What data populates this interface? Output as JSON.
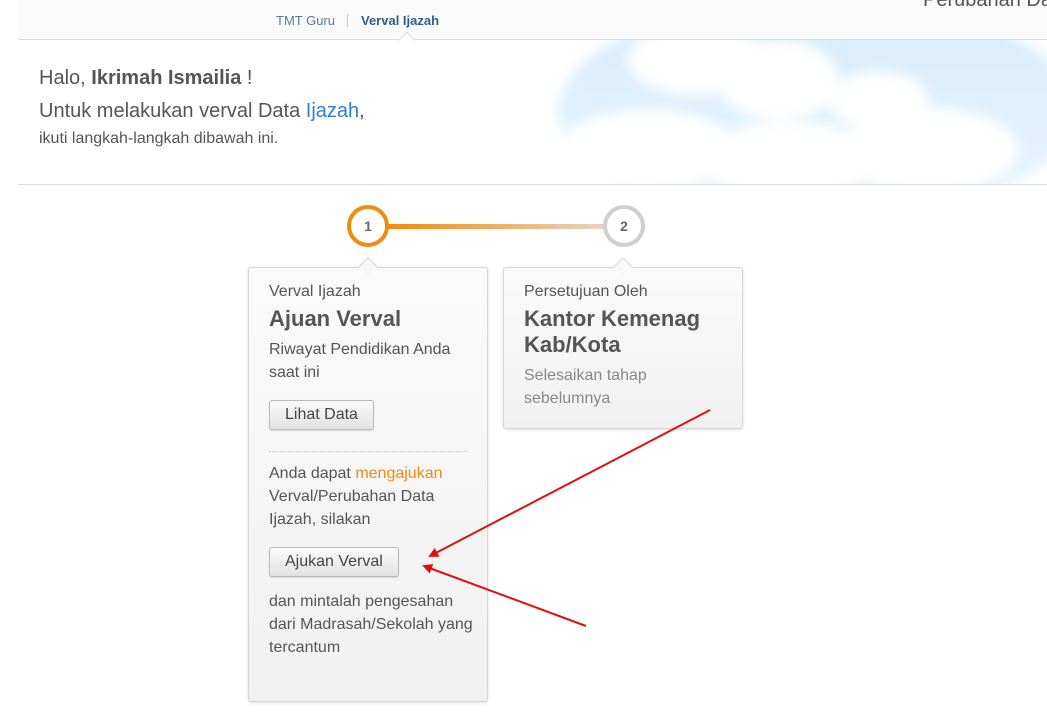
{
  "header": {
    "tabs": [
      {
        "label": "TMT Guru",
        "active": false
      },
      {
        "label": "Verval Ijazah",
        "active": true
      }
    ],
    "top_right_text": "Perubahan Da"
  },
  "greeting": {
    "hello": "Halo,",
    "name": "Ikrimah Ismailia",
    "exclaim": "!",
    "line2_prefix": "Untuk melakukan verval Data",
    "line2_highlight": "Ijazah",
    "line2_suffix": ",",
    "line3": "ikuti langkah-langkah dibawah ini."
  },
  "stepper": {
    "steps": [
      {
        "number": "1",
        "state": "active"
      },
      {
        "number": "2",
        "state": "pending"
      }
    ]
  },
  "cards": {
    "step1": {
      "subtitle": "Verval Ijazah",
      "title": "Ajuan Verval",
      "desc": "Riwayat Pendidikan Anda saat ini",
      "view_button": "Lihat Data",
      "note_prefix": "Anda dapat",
      "note_highlight": "mengajukan",
      "note_suffix": "Verval/Perubahan Data Ijazah, silakan",
      "submit_button": "Ajukan Verval",
      "footer": "dan mintalah pengesahan dari Madrasah/Sekolah yang tercantum"
    },
    "step2": {
      "subtitle": "Persetujuan Oleh",
      "title": "Kantor Kemenag Kab/Kota",
      "desc": "Selesaikan tahap sebelumnya"
    }
  },
  "colors": {
    "accent": "#f28a10",
    "link": "#2a7fd4",
    "annotation_arrow": "#e01010"
  }
}
